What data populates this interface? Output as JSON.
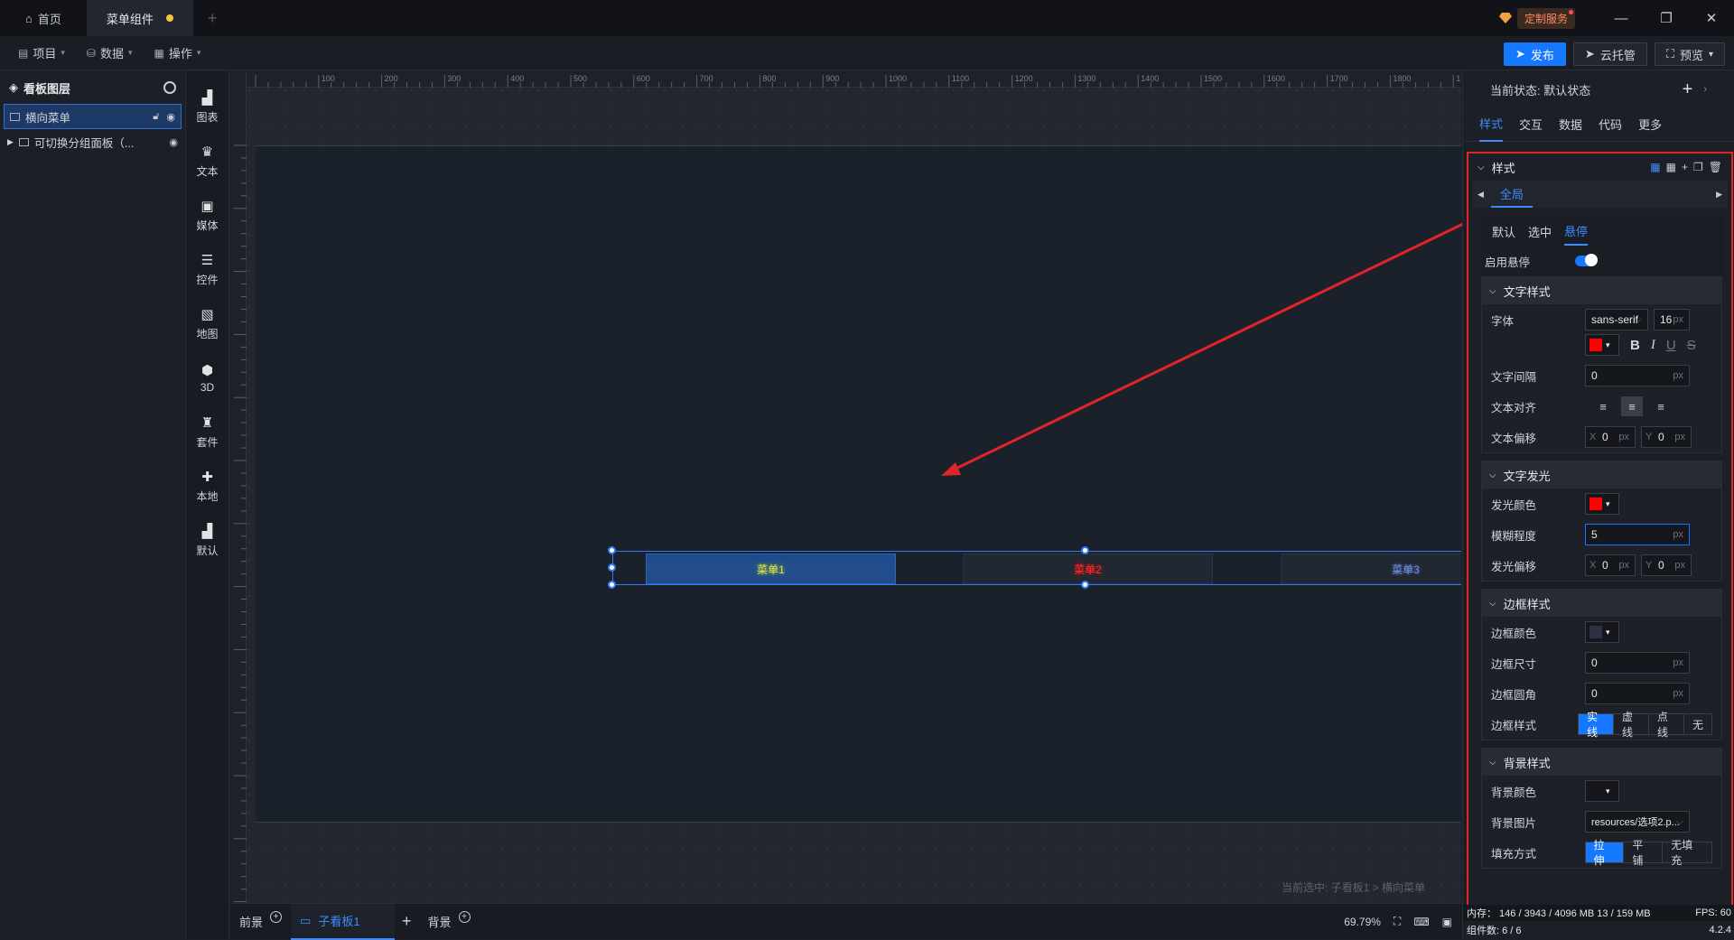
{
  "tabs": {
    "home": "首页",
    "current": "菜单组件"
  },
  "topright": {
    "service": "定制服务"
  },
  "toolbar": {
    "menus": [
      "项目",
      "数据",
      "操作"
    ],
    "publish": "发布",
    "cloud": "云托管",
    "preview": "预览"
  },
  "layers": {
    "title": "看板图层",
    "items": [
      "横向菜单",
      "可切换分组面板（..."
    ]
  },
  "sidebar": {
    "items": [
      "图表",
      "文本",
      "媒体",
      "控件",
      "地图",
      "3D",
      "套件",
      "本地",
      "默认"
    ]
  },
  "ruler": {
    "top_labels": [
      "100",
      "200",
      "300",
      "400",
      "500",
      "600",
      "700",
      "800",
      "900",
      "1000",
      "1100",
      "1200",
      "1300",
      "1400",
      "1500",
      "1600",
      "1700",
      "1800",
      "1900"
    ]
  },
  "canvas": {
    "menu_items": [
      "菜单1",
      "菜单2",
      "菜单3"
    ],
    "selection_note": "当前选中: 子看板1 > 横向菜单"
  },
  "bottom": {
    "front": "前景",
    "board": "子看板1",
    "background": "背景",
    "zoom": "69.79%"
  },
  "panel": {
    "state_label": "当前状态:  默认状态",
    "tabs": [
      "样式",
      "交互",
      "数据",
      "代码",
      "更多"
    ],
    "section": "样式",
    "subtab": "全局",
    "states": [
      "默认",
      "选中",
      "悬停"
    ],
    "enable_hover": "启用悬停",
    "text_style": {
      "title": "文字样式",
      "font_label": "字体",
      "font_value": "sans-serif",
      "font_size": "16",
      "spacing_label": "文字间隔",
      "spacing_value": "0",
      "align_label": "文本对齐",
      "offset_label": "文本偏移",
      "offset_x": "0",
      "offset_y": "0",
      "color": "#ff0000"
    },
    "glow": {
      "title": "文字发光",
      "color_label": "发光颜色",
      "color": "#ff0000",
      "blur_label": "模糊程度",
      "blur_value": "5",
      "offset_label": "发光偏移",
      "offset_x": "0",
      "offset_y": "0"
    },
    "border": {
      "title": "边框样式",
      "color_label": "边框颜色",
      "color": "#2b3245",
      "size_label": "边框尺寸",
      "size_value": "0",
      "radius_label": "边框圆角",
      "radius_value": "0",
      "style_label": "边框样式",
      "styles": [
        "实线",
        "虚线",
        "点线",
        "无"
      ]
    },
    "bg": {
      "title": "背景样式",
      "color_label": "背景颜色",
      "image_label": "背景图片",
      "image_value": "resources/选项2.p...",
      "fill_label": "填充方式",
      "fills": [
        "拉伸",
        "平铺",
        "无填充"
      ]
    },
    "unit": "px",
    "memory": "内存：  146 / 3943 / 4096 MB  13 / 159 MB",
    "fps": "FPS:  60",
    "count": "组件数: 6 / 6",
    "version": "4.2.4"
  }
}
